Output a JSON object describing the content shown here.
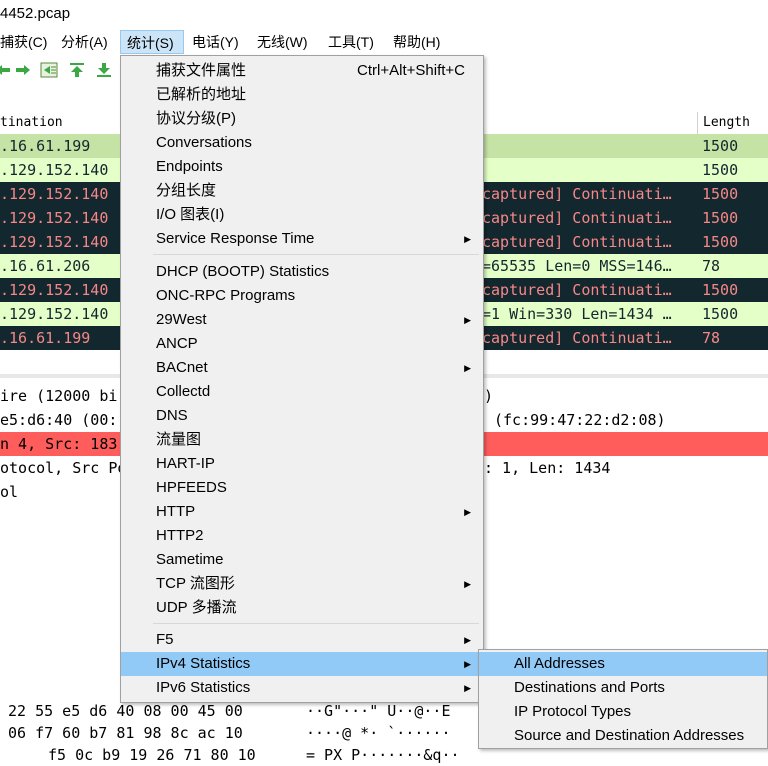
{
  "window": {
    "title": "4452.pcap"
  },
  "menubar": [
    {
      "label": "捕获(C)"
    },
    {
      "label": "分析(A)"
    },
    {
      "label": "统计(S)"
    },
    {
      "label": "电话(Y)"
    },
    {
      "label": "无线(W)"
    },
    {
      "label": "工具(T)"
    },
    {
      "label": "帮助(H)"
    }
  ],
  "toolbar": {
    "icons": [
      "go-back-icon",
      "go-forward-icon",
      "go-to-packet-icon",
      "go-first-icon",
      "go-last-icon"
    ]
  },
  "packet_list": {
    "headers": {
      "destination": "tination",
      "length": "Length"
    },
    "rows": [
      {
        "dest": ".16.61.199",
        "info": "",
        "length": "1500",
        "style": "ok"
      },
      {
        "dest": ".129.152.140",
        "info": "",
        "length": "1500",
        "style": "ok2"
      },
      {
        "dest": ".129.152.140",
        "info": "captured] Continuati…",
        "length": "1500",
        "style": "bad"
      },
      {
        "dest": ".129.152.140",
        "info": "captured] Continuati…",
        "length": "1500",
        "style": "bad"
      },
      {
        "dest": ".129.152.140",
        "info": "captured] Continuati…",
        "length": "1500",
        "style": "bad"
      },
      {
        "dest": ".16.61.206",
        "info": "=65535 Len=0 MSS=146…",
        "length": "78",
        "style": "ok2"
      },
      {
        "dest": ".129.152.140",
        "info": "captured] Continuati…",
        "length": "1500",
        "style": "bad"
      },
      {
        "dest": ".129.152.140",
        "info": "=1 Win=330 Len=1434 …",
        "length": "1500",
        "style": "ok2"
      },
      {
        "dest": ".16.61.199",
        "info": "captured] Continuati…",
        "length": "78",
        "style": "bad"
      }
    ]
  },
  "details": {
    "lines": [
      {
        "left": "ire (12000 bi",
        "right": ")"
      },
      {
        "left": "e5:d6:40 (00:",
        "right": "(fc:99:47:22:d2:08)"
      },
      {
        "left": "n 4, Src: 183",
        "right": ""
      },
      {
        "left": "otocol, Src Po",
        "right": ": 1, Len: 1434"
      },
      {
        "left": "ol",
        "right": ""
      }
    ]
  },
  "hex": {
    "rows": [
      {
        "bytes": "22  55 e5 d6 40 08 00 45 00",
        "ascii": "··G\"···\" U··@··E"
      },
      {
        "bytes": "06  f7 60 b7 81 98 8c ac 10",
        "ascii": "····@ *·  `······"
      },
      {
        "bytes": "f5 0c b9 19 26 71 80 10",
        "ascii": "= PX P·······&q··"
      }
    ]
  },
  "stats_menu": {
    "items": [
      {
        "label": "捕获文件属性",
        "shortcut": "Ctrl+Alt+Shift+C",
        "submenu": false
      },
      {
        "label": "已解析的地址",
        "shortcut": "",
        "submenu": false
      },
      {
        "label": "协议分级(P)",
        "shortcut": "",
        "submenu": false
      },
      {
        "label": "Conversations",
        "shortcut": "",
        "submenu": false
      },
      {
        "label": "Endpoints",
        "shortcut": "",
        "submenu": false
      },
      {
        "label": "分组长度",
        "shortcut": "",
        "submenu": false
      },
      {
        "label": "I/O 图表(I)",
        "shortcut": "",
        "submenu": false
      },
      {
        "label": "Service Response Time",
        "shortcut": "",
        "submenu": true
      },
      {
        "label": "DHCP (BOOTP) Statistics",
        "shortcut": "",
        "submenu": false
      },
      {
        "label": "ONC-RPC Programs",
        "shortcut": "",
        "submenu": false
      },
      {
        "label": "29West",
        "shortcut": "",
        "submenu": true
      },
      {
        "label": "ANCP",
        "shortcut": "",
        "submenu": false
      },
      {
        "label": "BACnet",
        "shortcut": "",
        "submenu": true
      },
      {
        "label": "Collectd",
        "shortcut": "",
        "submenu": false
      },
      {
        "label": "DNS",
        "shortcut": "",
        "submenu": false
      },
      {
        "label": "流量图",
        "shortcut": "",
        "submenu": false
      },
      {
        "label": "HART-IP",
        "shortcut": "",
        "submenu": false
      },
      {
        "label": "HPFEEDS",
        "shortcut": "",
        "submenu": false
      },
      {
        "label": "HTTP",
        "shortcut": "",
        "submenu": true
      },
      {
        "label": "HTTP2",
        "shortcut": "",
        "submenu": false
      },
      {
        "label": "Sametime",
        "shortcut": "",
        "submenu": false
      },
      {
        "label": "TCP 流图形",
        "shortcut": "",
        "submenu": true
      },
      {
        "label": "UDP 多播流",
        "shortcut": "",
        "submenu": false
      },
      {
        "label": "F5",
        "shortcut": "",
        "submenu": true
      },
      {
        "label": "IPv4 Statistics",
        "shortcut": "",
        "submenu": true,
        "highlighted": true
      },
      {
        "label": "IPv6 Statistics",
        "shortcut": "",
        "submenu": true
      }
    ]
  },
  "ipv4_submenu": {
    "items": [
      {
        "label": "All Addresses",
        "highlighted": true
      },
      {
        "label": "Destinations and Ports"
      },
      {
        "label": "IP Protocol Types"
      },
      {
        "label": "Source and Destination Addresses"
      }
    ]
  },
  "colors": {
    "menu_highlight": "#91c9f7",
    "row_good": "#c6e3a6",
    "row_good_light": "#e4ffc7",
    "row_bad_bg": "#12272e",
    "row_bad_fg": "#f78787",
    "detail_error": "#ff5c5c"
  },
  "arrow_glyph": "▶"
}
